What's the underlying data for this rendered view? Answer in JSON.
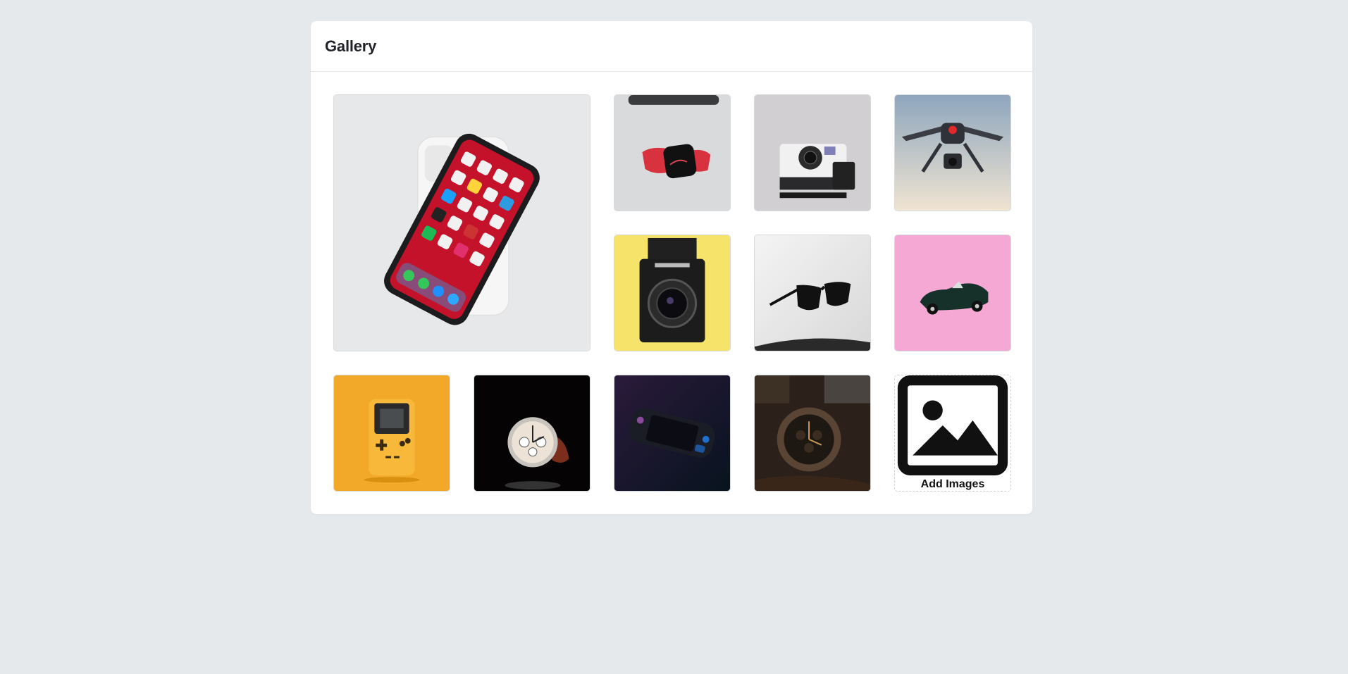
{
  "gallery": {
    "title": "Gallery",
    "add_label": "Add Images",
    "add_icon": "image-icon",
    "images": [
      {
        "name": "iphone-image",
        "bg": "#e6e8ea"
      },
      {
        "name": "smartwatch-image",
        "bg": "#d9dadb"
      },
      {
        "name": "instant-camera-image",
        "bg": "#d2cfd3"
      },
      {
        "name": "drone-image",
        "bg": "#a9bccb"
      },
      {
        "name": "medium-format-camera-image",
        "bg": "#f6e46a"
      },
      {
        "name": "sunglasses-image",
        "bg": "#ececec"
      },
      {
        "name": "toy-car-image",
        "bg": "#f5a8d3"
      },
      {
        "name": "game-console-image",
        "bg": "#f2a92a"
      },
      {
        "name": "chronograph-watch-image",
        "bg": "#050304"
      },
      {
        "name": "handheld-console-image",
        "bg": "#0d1c2d"
      },
      {
        "name": "wristwatch-image",
        "bg": "#2b211a"
      }
    ]
  }
}
